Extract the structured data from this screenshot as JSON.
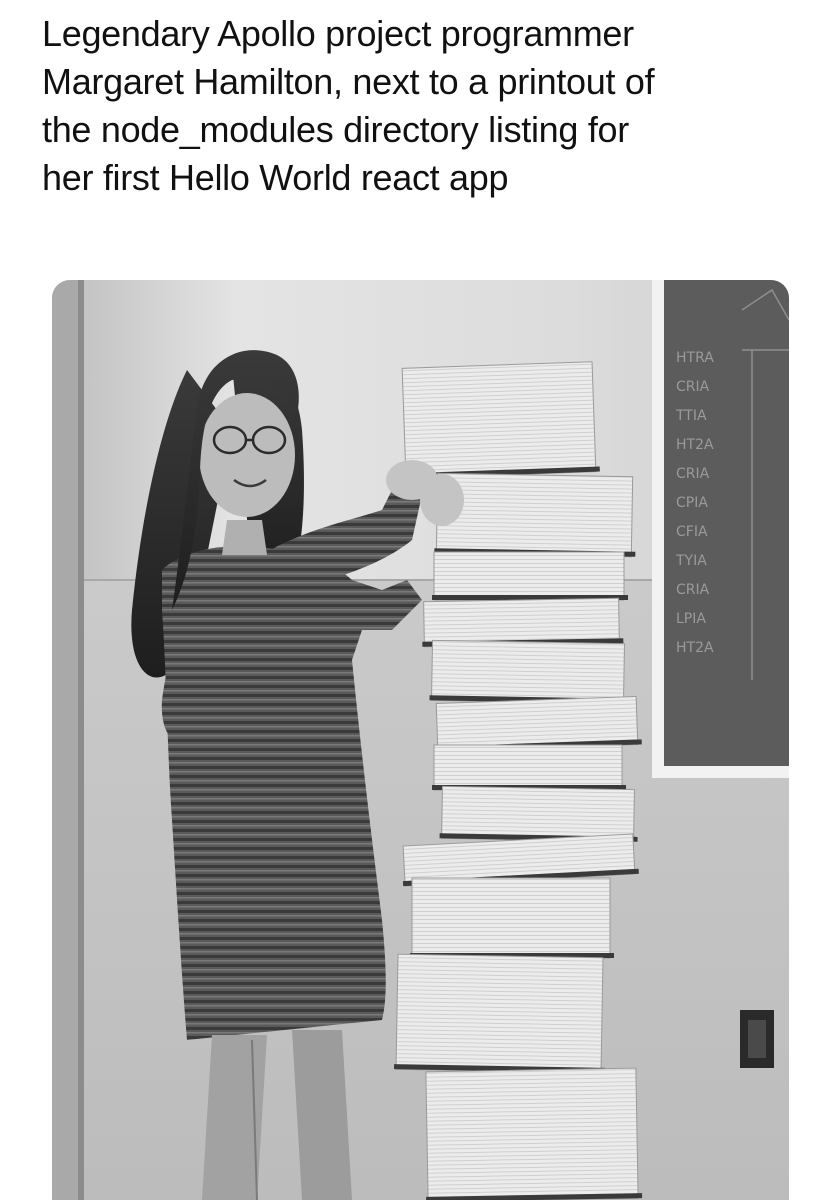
{
  "post": {
    "caption_lines": [
      "Legendary Apollo project programmer",
      "Margaret Hamilton, next to a printout of",
      "the node_modules directory listing for",
      "her first Hello World react app"
    ]
  },
  "photo": {
    "board_labels": [
      "HTRA",
      "CRIA",
      "TTIA",
      "HT2A",
      "CRIA",
      "CPIA",
      "CFIA",
      "TYIA",
      "CRIA",
      "LPIA",
      "HT2A"
    ]
  }
}
